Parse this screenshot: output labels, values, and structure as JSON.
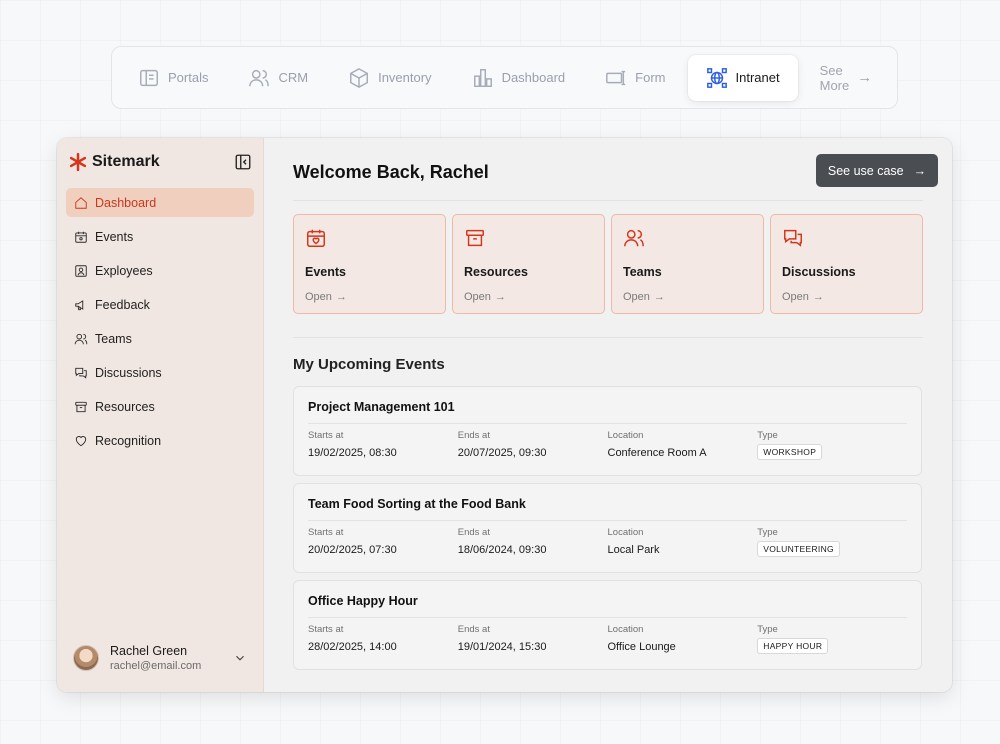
{
  "tabs": [
    {
      "label": "Portals",
      "icon": "portals-icon"
    },
    {
      "label": "CRM",
      "icon": "crm-icon"
    },
    {
      "label": "Inventory",
      "icon": "inventory-icon"
    },
    {
      "label": "Dashboard",
      "icon": "dashboard-icon"
    },
    {
      "label": "Form",
      "icon": "form-icon"
    },
    {
      "label": "Intranet",
      "icon": "intranet-icon",
      "active": true
    },
    {
      "label": "See More",
      "icon": "arrow-right-icon"
    }
  ],
  "brand": {
    "name": "Sitemark"
  },
  "sidebar": {
    "items": [
      {
        "label": "Dashboard",
        "icon": "home-icon",
        "active": true
      },
      {
        "label": "Events",
        "icon": "calendar-icon"
      },
      {
        "label": "Exployees",
        "icon": "id-card-icon"
      },
      {
        "label": "Feedback",
        "icon": "megaphone-icon"
      },
      {
        "label": "Teams",
        "icon": "users-icon"
      },
      {
        "label": "Discussions",
        "icon": "chat-icon"
      },
      {
        "label": "Resources",
        "icon": "archive-icon"
      },
      {
        "label": "Recognition",
        "icon": "heart-icon"
      }
    ]
  },
  "user": {
    "name": "Rachel Green",
    "email": "rachel@email.com"
  },
  "header": {
    "welcome": "Welcome Back, Rachel",
    "cta_label": "See use case"
  },
  "cards": [
    {
      "title": "Events",
      "open": "Open",
      "icon": "calendar-heart-icon"
    },
    {
      "title": "Resources",
      "open": "Open",
      "icon": "archive-icon"
    },
    {
      "title": "Teams",
      "open": "Open",
      "icon": "users-icon"
    },
    {
      "title": "Discussions",
      "open": "Open",
      "icon": "chat-icon"
    }
  ],
  "events_section": {
    "title": "My Upcoming Events"
  },
  "labels": {
    "starts": "Starts at",
    "ends": "Ends at",
    "location": "Location",
    "type": "Type"
  },
  "events": [
    {
      "title": "Project Management 101",
      "starts": "19/02/2025, 08:30",
      "ends": "20/07/2025, 09:30",
      "location": "Conference Room A",
      "type": "WORKSHOP"
    },
    {
      "title": "Team Food Sorting at the Food Bank",
      "starts": "20/02/2025, 07:30",
      "ends": "18/06/2024, 09:30",
      "location": "Local Park",
      "type": "VOLUNTEERING"
    },
    {
      "title": "Office Happy Hour",
      "starts": "28/02/2025, 14:00",
      "ends": "19/01/2024, 15:30",
      "location": "Office Lounge",
      "type": "HAPPY HOUR"
    }
  ],
  "colors": {
    "accent": "#d4351b",
    "sidebar_bg": "#f1e7e2",
    "active_tab_icon": "#2f5fe0",
    "cta_bg": "#4a4d52"
  }
}
